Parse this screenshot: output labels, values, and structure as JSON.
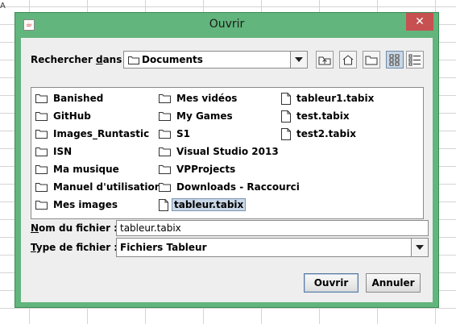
{
  "background": {
    "cell_label": "A"
  },
  "window": {
    "title": "Ouvrir",
    "close_label": "✕"
  },
  "look_in": {
    "label_prefix": "Rechercher ",
    "label_mnemonic": "d",
    "label_suffix": "ans :",
    "value": "Documents"
  },
  "toolbar": {
    "up_icon": "folder-up-icon",
    "home_icon": "home-icon",
    "new_folder_icon": "new-folder-icon",
    "list_view_icon": "list-view-icon",
    "details_view_icon": "details-view-icon"
  },
  "files": {
    "col1": [
      {
        "name": "Banished",
        "type": "folder"
      },
      {
        "name": "GitHub",
        "type": "folder"
      },
      {
        "name": "Images_Runtastic",
        "type": "folder"
      },
      {
        "name": "ISN",
        "type": "folder"
      },
      {
        "name": "Ma musique",
        "type": "folder"
      },
      {
        "name": "Manuel d'utilisation",
        "type": "folder"
      },
      {
        "name": "Mes images",
        "type": "folder"
      }
    ],
    "col2": [
      {
        "name": "Mes vidéos",
        "type": "folder"
      },
      {
        "name": "My Games",
        "type": "folder"
      },
      {
        "name": "S1",
        "type": "folder"
      },
      {
        "name": "Visual Studio 2013",
        "type": "folder"
      },
      {
        "name": "VPProjects",
        "type": "folder"
      },
      {
        "name": "Downloads - Raccourci",
        "type": "folder"
      },
      {
        "name": "tableur.tabix",
        "type": "file"
      }
    ],
    "col3": [
      {
        "name": "tableur1.tabix",
        "type": "file"
      },
      {
        "name": "test.tabix",
        "type": "file"
      },
      {
        "name": "test2.tabix",
        "type": "file"
      }
    ]
  },
  "filename": {
    "label_mnemonic": "N",
    "label_suffix": "om du fichier :",
    "value": "tableur.tabix"
  },
  "filetype": {
    "label_mnemonic": "T",
    "label_suffix": "ype de fichier :",
    "value": "Fichiers Tableur"
  },
  "buttons": {
    "open": "Ouvrir",
    "cancel": "Annuler"
  },
  "colors": {
    "frame": "#62b57c",
    "selection": "#c9d7e6"
  }
}
